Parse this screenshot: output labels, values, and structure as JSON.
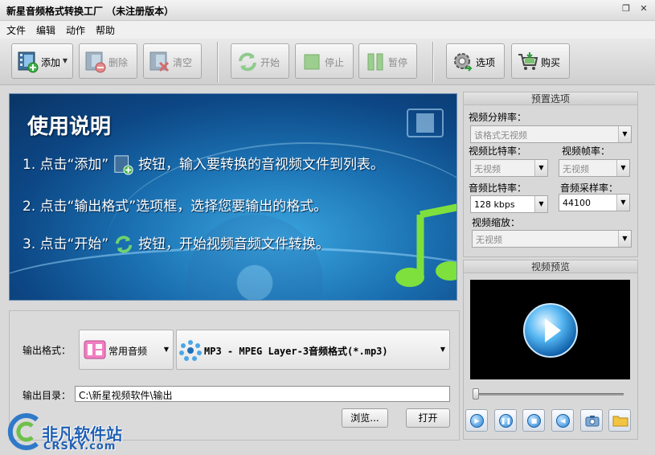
{
  "window": {
    "title": "新星音频格式转换工厂 （未注册版本）",
    "controls": [
      "restore-icon",
      "close-icon"
    ]
  },
  "menu": [
    "文件",
    "编辑",
    "动作",
    "帮助"
  ],
  "toolbar": {
    "add": "添加",
    "delete": "删除",
    "clear": "清空",
    "start": "开始",
    "stop": "停止",
    "pause": "暂停",
    "options": "选项",
    "buy": "购买"
  },
  "banner": {
    "heading": "使用说明",
    "step1_a": "1. 点击“添加”",
    "step1_b": "按钮，输入要转换的音视频文件到列表。",
    "step2": "2. 点击“输出格式”选项框，选择您要输出的格式。",
    "step3_a": "3. 点击“开始”",
    "step3_b": "按钮，开始视频音频文件转换。"
  },
  "output": {
    "format_label": "输出格式：",
    "category": "常用音频",
    "format": "MP3 - MPEG Layer-3音频格式(*.mp3)",
    "dir_label": "输出目录：",
    "dir_value": "C:\\新星视频软件\\输出",
    "browse": "浏览...",
    "open": "打开"
  },
  "preset": {
    "title": "预置选项",
    "resolution_label": "视频分辨率：",
    "resolution": "该格式无视频",
    "vbitrate_label": "视频比特率：",
    "vbitrate": "无视频",
    "fps_label": "视频帧率：",
    "fps": "无视频",
    "abitrate_label": "音频比特率：",
    "abitrate": "128 kbps",
    "samplerate_label": "音频采样率：",
    "samplerate": "44100",
    "zoom_label": "视频缩放：",
    "zoom": "无视频"
  },
  "preview": {
    "title": "视频预览",
    "position": 0
  },
  "watermark": {
    "name": "非凡软件站",
    "domain": "CRSKY.com"
  }
}
